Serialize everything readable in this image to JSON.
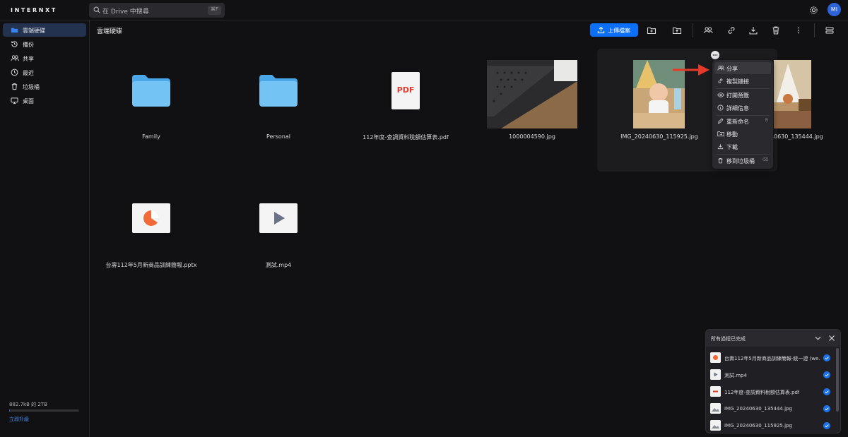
{
  "app": {
    "logo": "INTERNXT",
    "avatar_initials": "MI"
  },
  "search": {
    "placeholder": "在 Drive 中搜尋",
    "shortcut": "⌘F"
  },
  "sidebar": {
    "items": [
      {
        "label": "雲端硬碟",
        "icon": "folder-icon",
        "active": true
      },
      {
        "label": "備份",
        "icon": "history-icon",
        "active": false
      },
      {
        "label": "共享",
        "icon": "users-icon",
        "active": false
      },
      {
        "label": "最近",
        "icon": "clock-icon",
        "active": false
      },
      {
        "label": "垃圾桶",
        "icon": "trash-icon",
        "active": false
      },
      {
        "label": "桌面",
        "icon": "desktop-icon",
        "active": false
      }
    ],
    "storage_text": "882.7kB 的 2TB",
    "storage_used_fraction": 0.0005,
    "upgrade_label": "立即升級"
  },
  "header": {
    "breadcrumb": "雲端硬碟",
    "upload_label": "上傳檔案"
  },
  "files": [
    {
      "name": "Family",
      "type": "folder"
    },
    {
      "name": "Personal",
      "type": "folder"
    },
    {
      "name": "112年度-查調資料稅額估算表.pdf",
      "type": "pdf",
      "thumb_text": "PDF"
    },
    {
      "name": "1000004590.jpg",
      "type": "image"
    },
    {
      "name": "IMG_20240630_115925.jpg",
      "type": "image",
      "selected": true
    },
    {
      "name": "IMG_20240630_135444.jpg",
      "type": "image"
    },
    {
      "name": "台壽112年5月新商品訓練簡報.pptx",
      "type": "pptx"
    },
    {
      "name": "測試.mp4",
      "type": "video"
    }
  ],
  "context_menu": {
    "items": [
      {
        "label": "分享",
        "icon": "users-icon",
        "shortcut": ""
      },
      {
        "label": "複製鏈接",
        "icon": "link-icon",
        "shortcut": ""
      },
      {
        "label": "打開預覽",
        "icon": "eye-icon",
        "shortcut": ""
      },
      {
        "label": "詳細信息",
        "icon": "info-icon",
        "shortcut": ""
      },
      {
        "label": "重新命名",
        "icon": "pencil-icon",
        "shortcut": "R"
      },
      {
        "label": "移動",
        "icon": "folder-move-icon",
        "shortcut": ""
      },
      {
        "label": "下載",
        "icon": "download-icon",
        "shortcut": ""
      },
      {
        "label": "移到垃圾桶",
        "icon": "trash-icon",
        "shortcut": "⌫"
      }
    ]
  },
  "upload_panel": {
    "title": "所有過程已完成",
    "items": [
      {
        "name": "台壽112年5月新商品訓練簡報-統一證 (we…",
        "type": "pptx"
      },
      {
        "name": "測試.mp4",
        "type": "video"
      },
      {
        "name": "112年度-查調資料稅額估算表.pdf",
        "type": "pdf"
      },
      {
        "name": "IMG_20240630_135444.jpg",
        "type": "image"
      },
      {
        "name": "IMG_20240630_115925.jpg",
        "type": "image"
      }
    ]
  },
  "colors": {
    "accent": "#0c6ff9",
    "bg": "#111113",
    "arrow": "#e53a2a"
  }
}
